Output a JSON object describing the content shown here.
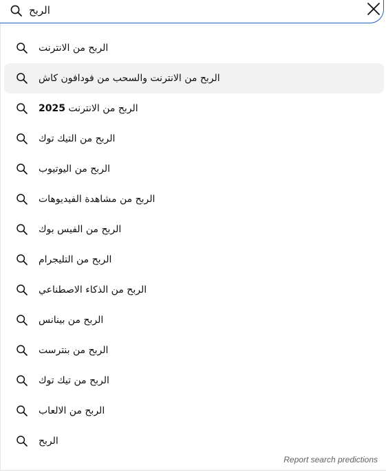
{
  "search": {
    "value": "الربح",
    "icon": "search-icon",
    "clear_icon": "close-icon"
  },
  "suggestions": [
    {
      "text": "الربح من الانترنت",
      "highlighted": false
    },
    {
      "text": "الربح من الانترنت والسحب من فودافون كاش",
      "highlighted": true
    },
    {
      "text": "الربح من الانترنت 2025",
      "highlighted": false
    },
    {
      "text": "الربح من التيك توك",
      "highlighted": false
    },
    {
      "text": "الربح من اليوتيوب",
      "highlighted": false
    },
    {
      "text": "الربح من مشاهدة الفيديوهات",
      "highlighted": false
    },
    {
      "text": "الربح من الفيس بوك",
      "highlighted": false
    },
    {
      "text": "الربح من التليجرام",
      "highlighted": false
    },
    {
      "text": "الربح من الذكاء الاصطناعي",
      "highlighted": false
    },
    {
      "text": "الربح من بينانس",
      "highlighted": false
    },
    {
      "text": "الربح من بنترست",
      "highlighted": false
    },
    {
      "text": "الربح من تيك توك",
      "highlighted": false
    },
    {
      "text": "الربح من الالعاب",
      "highlighted": false
    },
    {
      "text": "الربح",
      "highlighted": false
    }
  ],
  "report": {
    "label": "Report search predictions"
  },
  "colors": {
    "focus_border": "#1c62b9",
    "highlight_bg": "#f2f2f2",
    "text": "#0f0f0f",
    "muted": "#606060"
  }
}
